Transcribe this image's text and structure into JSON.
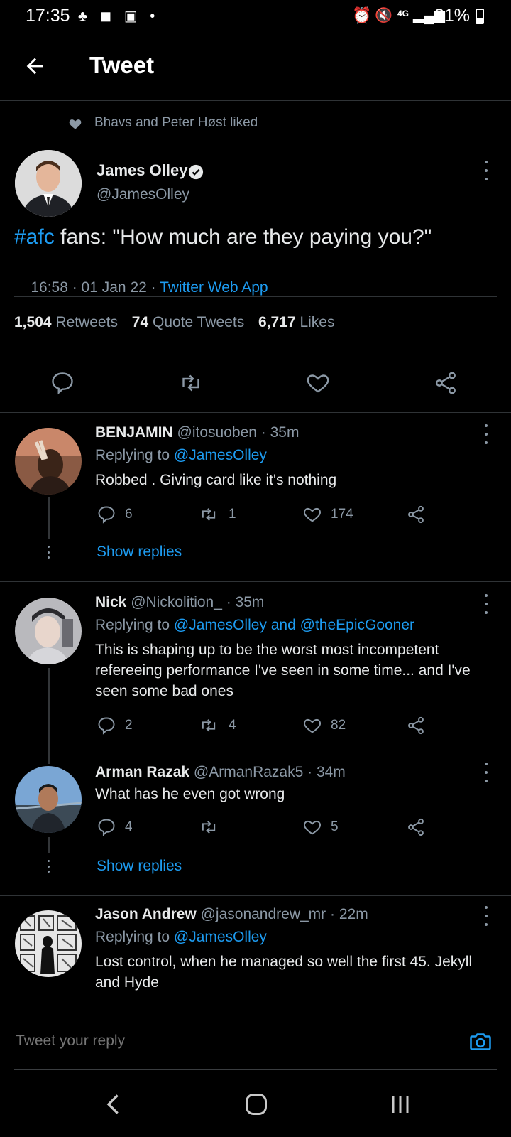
{
  "status_bar": {
    "time": "17:35",
    "network": "4G",
    "battery": "31%"
  },
  "header": {
    "title": "Tweet"
  },
  "social_context": "Bhavs and Peter Høst liked",
  "main_tweet": {
    "name": "James Olley",
    "handle": "@JamesOlley",
    "hashtag": "#afc",
    "text_rest": " fans: \"How much are they paying you?\"",
    "time_date": "16:58 · 01 Jan 22 · ",
    "source": "Twitter Web App",
    "stats": {
      "retweets_count": "1,504",
      "retweets_label": "Retweets",
      "quotes_count": "74",
      "quotes_label": "Quote Tweets",
      "likes_count": "6,717",
      "likes_label": "Likes"
    }
  },
  "replies": [
    {
      "name": "BENJAMIN",
      "handle": "@itosuoben",
      "time": "· 35m",
      "replying_prefix": "Replying to ",
      "replying_to": "@JamesOlley",
      "text": "Robbed . Giving card like it's nothing",
      "replies": "6",
      "retweets": "1",
      "likes": "174"
    },
    {
      "name": "Nick",
      "handle": "@Nickolition_",
      "time": "· 35m",
      "replying_prefix": "Replying to ",
      "replying_to": "@JamesOlley and @theEpicGooner",
      "text": "This is shaping up to be the worst most incompetent refereeing performance I've seen in some time... and I've seen some bad ones",
      "replies": "2",
      "retweets": "4",
      "likes": "82"
    },
    {
      "name": "Arman Razak",
      "handle": "@ArmanRazak5",
      "time": "· 34m",
      "text": "What has he even got wrong",
      "replies": "4",
      "retweets": "",
      "likes": "5"
    },
    {
      "name": "Jason Andrew",
      "handle": "@jasonandrew_mr",
      "time": "· 22m",
      "replying_prefix": "Replying to ",
      "replying_to": "@JamesOlley",
      "text": "Lost control, when he managed so well the first 45. Jekyll and Hyde"
    }
  ],
  "show_replies_label": "Show replies",
  "compose": {
    "placeholder": "Tweet your reply"
  },
  "colors": {
    "accent": "#1d9bf0",
    "background": "#000000",
    "muted": "#8b98a5"
  }
}
